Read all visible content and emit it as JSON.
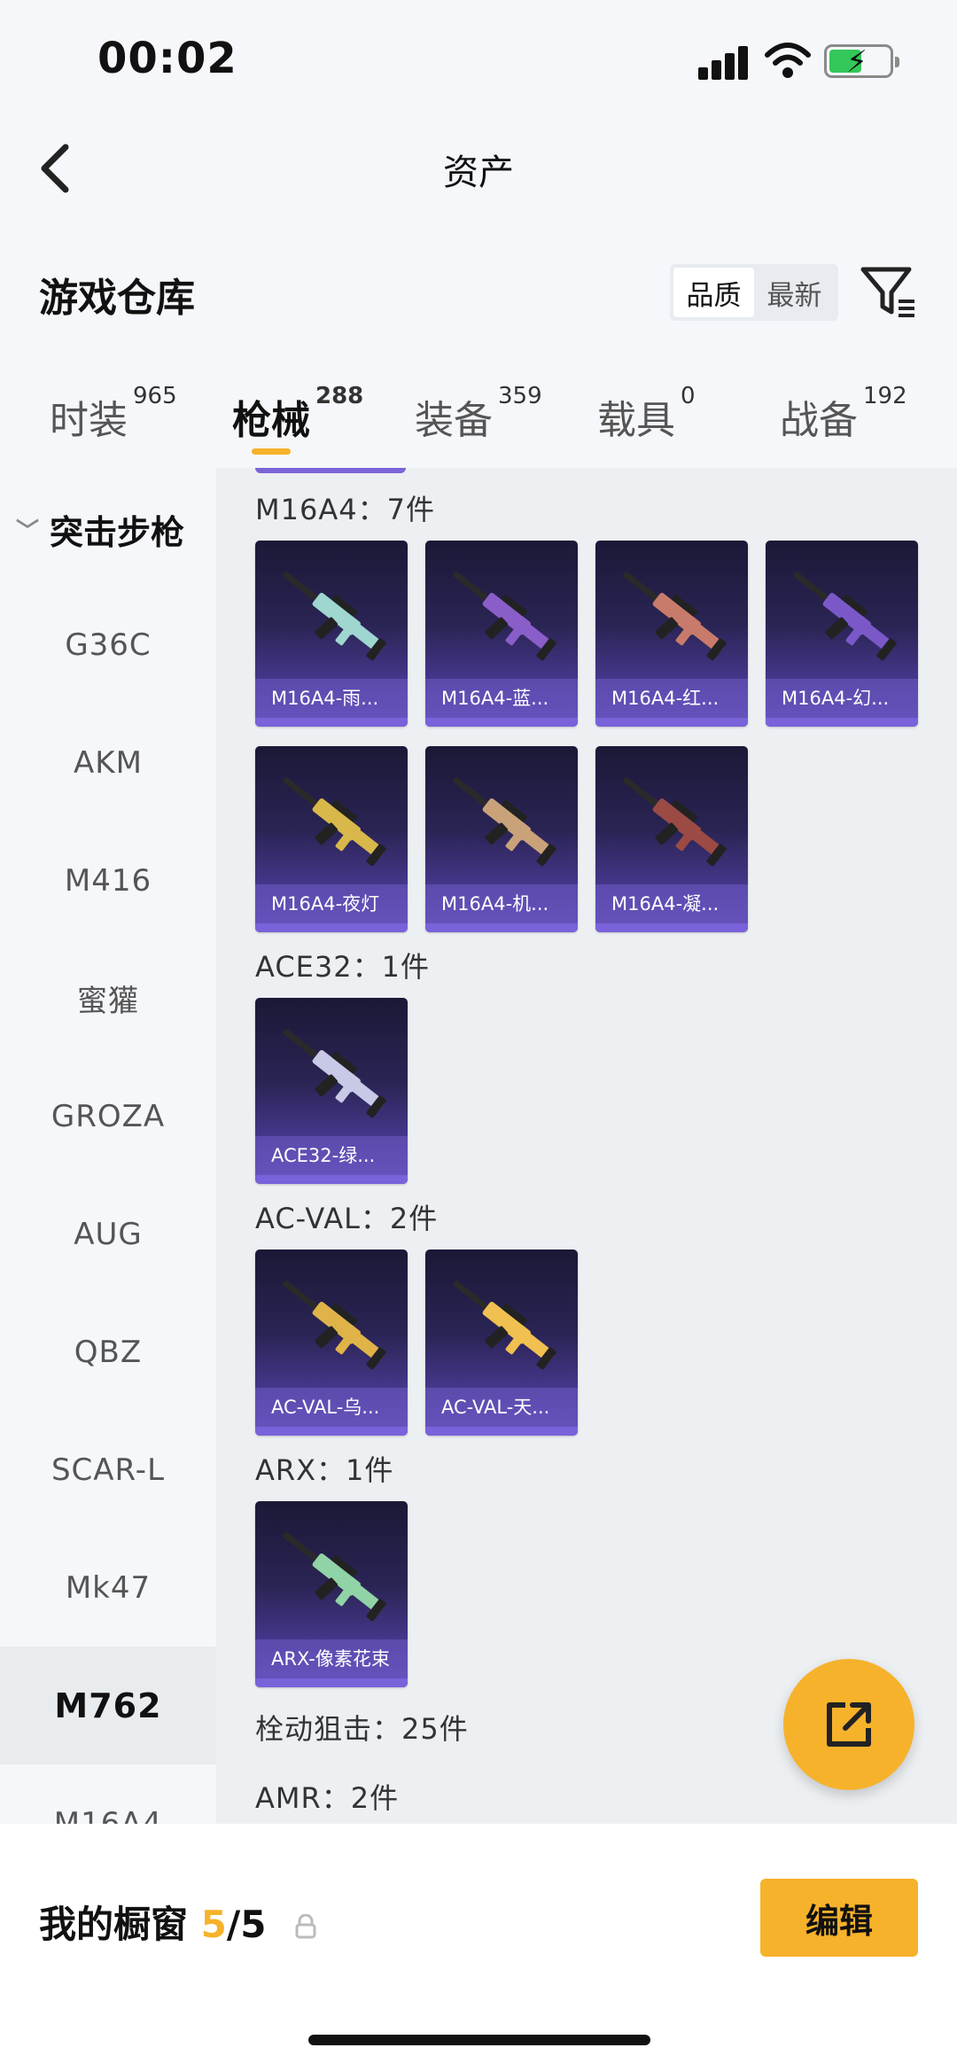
{
  "status": {
    "time": "00:02"
  },
  "header": {
    "title": "资产"
  },
  "warehouse": {
    "title": "游戏仓库",
    "sort_options": [
      "品质",
      "最新"
    ],
    "active_sort": 0
  },
  "tabs": [
    {
      "label": "时装",
      "count": "965"
    },
    {
      "label": "枪械",
      "count": "288"
    },
    {
      "label": "装备",
      "count": "359"
    },
    {
      "label": "载具",
      "count": "0"
    },
    {
      "label": "战备",
      "count": "192"
    }
  ],
  "sidebar": {
    "category": "突击步枪",
    "items": [
      "G36C",
      "AKM",
      "M416",
      "蜜獾",
      "GROZA",
      "AUG",
      "QBZ",
      "SCAR-L",
      "Mk47",
      "M762",
      "M16A4"
    ],
    "active_index": 9
  },
  "sections": [
    {
      "title": "M16A4：7件",
      "items": [
        {
          "label": "M16A4-雨...",
          "skin": "#9fd6d0"
        },
        {
          "label": "M16A4-蓝...",
          "skin": "#8a5ec9"
        },
        {
          "label": "M16A4-红...",
          "skin": "#c87b6a"
        },
        {
          "label": "M16A4-幻...",
          "skin": "#7a58c8"
        },
        {
          "label": "M16A4-夜灯",
          "skin": "#d8b84a"
        },
        {
          "label": "M16A4-机...",
          "skin": "#c9a27a"
        },
        {
          "label": "M16A4-凝...",
          "skin": "#9b4a44"
        }
      ]
    },
    {
      "title": "ACE32：1件",
      "items": [
        {
          "label": "ACE32-绿...",
          "skin": "#c7c9e6"
        }
      ]
    },
    {
      "title": "AC-VAL：2件",
      "items": [
        {
          "label": "AC-VAL-乌...",
          "skin": "#e0b348"
        },
        {
          "label": "AC-VAL-天...",
          "skin": "#f0c050"
        }
      ]
    },
    {
      "title": "ARX：1件",
      "items": [
        {
          "label": "ARX-像素花束",
          "skin": "#8fd3a6"
        }
      ]
    }
  ],
  "more_sections": [
    {
      "title": "栓动狙击：25件"
    },
    {
      "title": "AMR：2件"
    }
  ],
  "bottom": {
    "shop_label": "我的橱窗",
    "shop_used": "5",
    "shop_total": "/5",
    "edit_label": "编辑"
  }
}
